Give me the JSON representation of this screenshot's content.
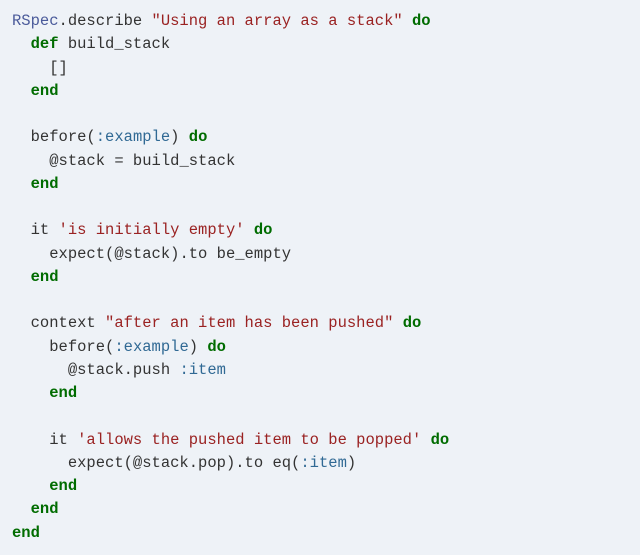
{
  "code_lines": [
    {
      "indent": 0,
      "tokens": [
        {
          "cls": "cls",
          "t": "RSpec"
        },
        {
          "cls": "id",
          "t": ".describe "
        },
        {
          "cls": "str",
          "t": "\"Using an array as a stack\""
        },
        {
          "cls": "id",
          "t": " "
        },
        {
          "cls": "k",
          "t": "do"
        }
      ]
    },
    {
      "indent": 1,
      "tokens": [
        {
          "cls": "k",
          "t": "def"
        },
        {
          "cls": "id",
          "t": " build_stack"
        }
      ]
    },
    {
      "indent": 2,
      "tokens": [
        {
          "cls": "id",
          "t": "[]"
        }
      ]
    },
    {
      "indent": 1,
      "tokens": [
        {
          "cls": "k",
          "t": "end"
        }
      ]
    },
    {
      "indent": 0,
      "tokens": [
        {
          "cls": "id",
          "t": ""
        }
      ]
    },
    {
      "indent": 1,
      "tokens": [
        {
          "cls": "id",
          "t": "before("
        },
        {
          "cls": "sym",
          "t": ":example"
        },
        {
          "cls": "id",
          "t": ") "
        },
        {
          "cls": "k",
          "t": "do"
        }
      ]
    },
    {
      "indent": 2,
      "tokens": [
        {
          "cls": "id",
          "t": "@stack = build_stack"
        }
      ]
    },
    {
      "indent": 1,
      "tokens": [
        {
          "cls": "k",
          "t": "end"
        }
      ]
    },
    {
      "indent": 0,
      "tokens": [
        {
          "cls": "id",
          "t": ""
        }
      ]
    },
    {
      "indent": 1,
      "tokens": [
        {
          "cls": "id",
          "t": "it "
        },
        {
          "cls": "str",
          "t": "'is initially empty'"
        },
        {
          "cls": "id",
          "t": " "
        },
        {
          "cls": "k",
          "t": "do"
        }
      ]
    },
    {
      "indent": 2,
      "tokens": [
        {
          "cls": "id",
          "t": "expect(@stack).to be_empty"
        }
      ]
    },
    {
      "indent": 1,
      "tokens": [
        {
          "cls": "k",
          "t": "end"
        }
      ]
    },
    {
      "indent": 0,
      "tokens": [
        {
          "cls": "id",
          "t": ""
        }
      ]
    },
    {
      "indent": 1,
      "tokens": [
        {
          "cls": "id",
          "t": "context "
        },
        {
          "cls": "str",
          "t": "\"after an item has been pushed\""
        },
        {
          "cls": "id",
          "t": " "
        },
        {
          "cls": "k",
          "t": "do"
        }
      ]
    },
    {
      "indent": 2,
      "tokens": [
        {
          "cls": "id",
          "t": "before("
        },
        {
          "cls": "sym",
          "t": ":example"
        },
        {
          "cls": "id",
          "t": ") "
        },
        {
          "cls": "k",
          "t": "do"
        }
      ]
    },
    {
      "indent": 3,
      "tokens": [
        {
          "cls": "id",
          "t": "@stack.push "
        },
        {
          "cls": "sym",
          "t": ":item"
        }
      ]
    },
    {
      "indent": 2,
      "tokens": [
        {
          "cls": "k",
          "t": "end"
        }
      ]
    },
    {
      "indent": 0,
      "tokens": [
        {
          "cls": "id",
          "t": ""
        }
      ]
    },
    {
      "indent": 2,
      "tokens": [
        {
          "cls": "id",
          "t": "it "
        },
        {
          "cls": "str",
          "t": "'allows the pushed item to be popped'"
        },
        {
          "cls": "id",
          "t": " "
        },
        {
          "cls": "k",
          "t": "do"
        }
      ]
    },
    {
      "indent": 3,
      "tokens": [
        {
          "cls": "id",
          "t": "expect(@stack.pop).to eq("
        },
        {
          "cls": "sym",
          "t": ":item"
        },
        {
          "cls": "id",
          "t": ")"
        }
      ]
    },
    {
      "indent": 2,
      "tokens": [
        {
          "cls": "k",
          "t": "end"
        }
      ]
    },
    {
      "indent": 1,
      "tokens": [
        {
          "cls": "k",
          "t": "end"
        }
      ]
    },
    {
      "indent": 0,
      "tokens": [
        {
          "cls": "k",
          "t": "end"
        }
      ]
    }
  ],
  "indent_unit": "  "
}
